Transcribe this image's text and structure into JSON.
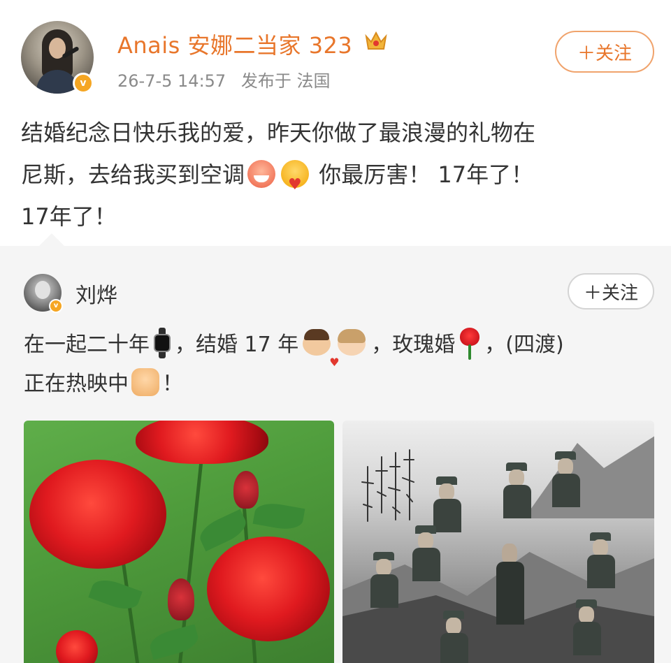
{
  "post": {
    "username": "Anais 安娜二当家 323",
    "datetime": "26-7-5 14:57",
    "location": "发布于 法国",
    "follow_label": "＋关注",
    "text_line1": "结婚纪念日快乐我的爱，昨天你做了最浪漫的礼物在",
    "text_line2_a": "尼斯，去给我买到空调",
    "text_line2_b": "你最厉害！ 17年了！",
    "text_line3": "17年了！"
  },
  "repost": {
    "username": "刘烨",
    "follow_label": "＋关注",
    "text_a": "在一起二十年",
    "text_b": "，结婚 17 年",
    "text_c": "，玫瑰婚",
    "text_d": "，(四渡)",
    "text_e": "正在热映中",
    "text_f": "！",
    "images": [
      {
        "icon": "red-roses-photo"
      },
      {
        "icon": "movie-poster"
      }
    ]
  },
  "colors": {
    "username": "#e8762b",
    "meta": "#8a8a8a",
    "verified": "#f5a623",
    "repost_bg": "#f5f5f5"
  },
  "icons": [
    "crown-icon",
    "verified-badge-icon",
    "laugh-emoji",
    "love-emoji",
    "watch-emoji",
    "couple-emoji",
    "rose-emoji",
    "fist-emoji"
  ]
}
